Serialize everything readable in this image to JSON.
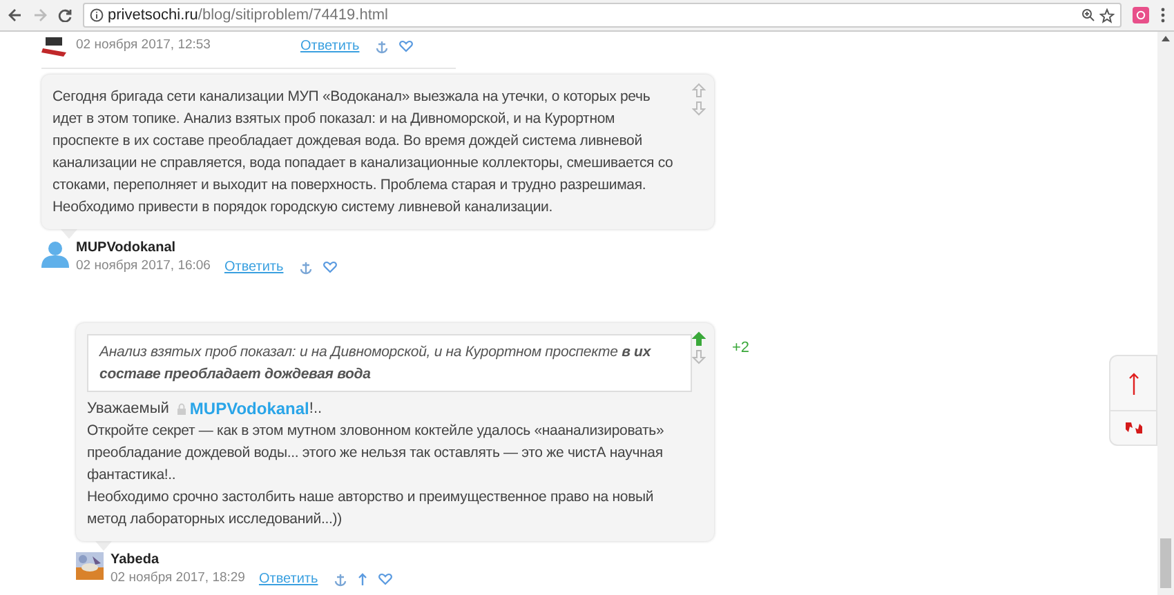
{
  "browser": {
    "url_host": "privetsochi.ru",
    "url_path": "/blog/sitiproblem/74419.html"
  },
  "top_meta": {
    "date": "02 ноября 2017, 12:53",
    "reply": "Ответить"
  },
  "comments": [
    {
      "indent": false,
      "upvoted": false,
      "paragraphs": [
        "Сегодня бригада сети канализации МУП «Водоканал» выезжала на утечки, о которых речь идет в этом топике. Анализ взятых проб показал: и на Дивноморской, и на Курортном проспекте в их составе преобладает дождевая вода. Во время дождей система ливневой канализации не справляется, вода попадает в канализационные коллекторы, смешивается со стоками, переполняет и выходит на поверхность. Проблема старая и трудно разрешимая. Необходимо привести в порядок городскую систему ливневой канализации."
      ],
      "author": "MUPVodokanal",
      "kind": "silhouette",
      "date": "02 ноября 2017, 16:06",
      "reply": "Ответить",
      "parent_link": false
    },
    {
      "indent": true,
      "upvoted": true,
      "votes": "+2",
      "quote": "Анализ взятых проб показал: и на Дивноморской, и на Курортном проспекте **в их составе преобладает дождевая вода**",
      "greeting": {
        "before": "Уважаемый",
        "user": "MUPVodokanal",
        "after": "!.."
      },
      "paragraphs": [
        "Откройте секрет — как в этом мутном зловонном коктейле удалось «наанализировать» преобладание дождевой воды... этого же нельзя так оставлять — это же чистА научная фантастика!..",
        "Необходимо срочно застолбить наше авторство и преимущественное право на новый метод лабораторных исследований...))"
      ],
      "author": "Yabeda",
      "kind": "picture",
      "date": "02 ноября 2017, 18:29",
      "reply": "Ответить",
      "parent_link": true
    }
  ]
}
